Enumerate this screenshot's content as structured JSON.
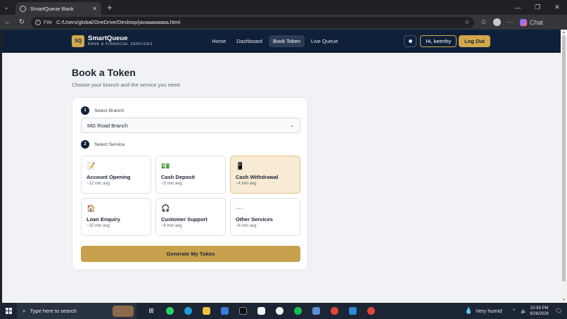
{
  "browser": {
    "tab_title": "SmartQueue Bank",
    "url_scheme": "File",
    "url": "C:/Users/global/OneDrive/Desktop/javaaaaaaaa.html",
    "chat_label": "Chat"
  },
  "app": {
    "brand_mark": "SQ",
    "brand_name": "SmartQueue",
    "brand_sub": "BANK & FINANCIAL SERVICES",
    "nav": [
      {
        "label": "Home",
        "active": false
      },
      {
        "label": "Dashboard",
        "active": false
      },
      {
        "label": "Book Token",
        "active": true
      },
      {
        "label": "Live Queue",
        "active": false
      }
    ],
    "greeting": "Hi, keerthy",
    "logout_label": "Log Out"
  },
  "page": {
    "title": "Book a Token",
    "subtitle": "Choose your branch and the service you need.",
    "step1": {
      "num": "1",
      "label": "Select Branch"
    },
    "branch_value": "MG Road Branch",
    "step2": {
      "num": "2",
      "label": "Select Service"
    },
    "services": [
      {
        "icon": "📝",
        "icon_name": "form-icon",
        "name": "Account Opening",
        "avg": "~12 min avg",
        "selected": false
      },
      {
        "icon": "💵",
        "icon_name": "cash-icon",
        "name": "Cash Deposit",
        "avg": "~5 min avg",
        "selected": false
      },
      {
        "icon": "📱",
        "icon_name": "atm-icon",
        "name": "Cash Withdrawal",
        "avg": "~4 min avg",
        "selected": true
      },
      {
        "icon": "🏠",
        "icon_name": "house-icon",
        "name": "Loan Enquiry",
        "avg": "~15 min avg",
        "selected": false
      },
      {
        "icon": "🎧",
        "icon_name": "headset-icon",
        "name": "Customer Support",
        "avg": "~8 min avg",
        "selected": false
      },
      {
        "icon": "⋯",
        "icon_name": "more-icon",
        "name": "Other Services",
        "avg": "~6 min avg",
        "selected": false
      }
    ],
    "generate_label": "Generate My Token"
  },
  "taskbar": {
    "search_placeholder": "Type here to search",
    "weather": "Very humid",
    "time": "10:59 PM",
    "date": "8/26/2026"
  },
  "colors": {
    "navy": "#0f2039",
    "gold": "#d1a84d",
    "selected_bg": "#f8ebd3"
  }
}
